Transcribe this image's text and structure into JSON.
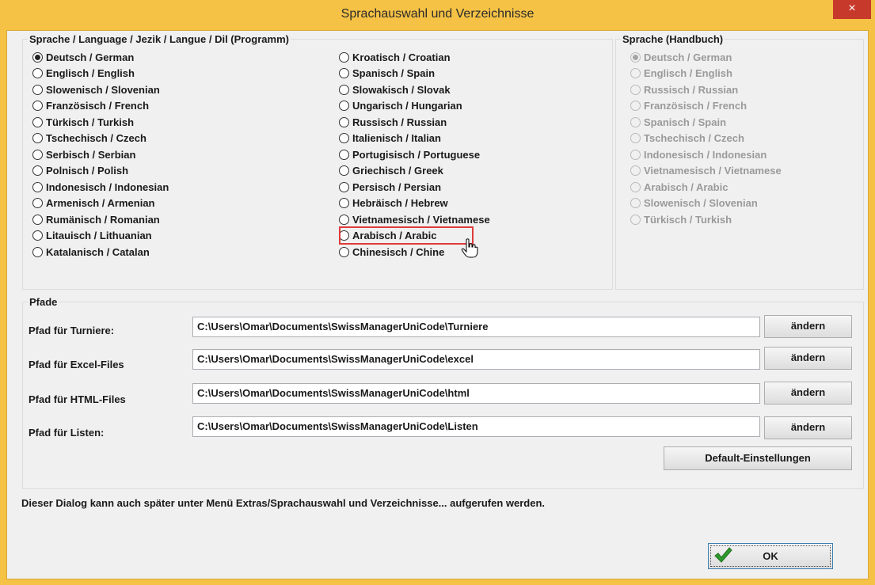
{
  "window": {
    "title": "Sprachauswahl und Verzeichnisse",
    "close": "×"
  },
  "program_language": {
    "legend": "Sprache / Language / Jezik / Langue / Dil (Programm)",
    "selected": "Deutsch / German",
    "col1": [
      "Deutsch / German",
      "Englisch / English",
      "Slowenisch / Slovenian",
      "Französisch / French",
      "Türkisch / Turkish",
      "Tschechisch / Czech",
      "Serbisch / Serbian",
      "Polnisch / Polish",
      "Indonesisch / Indonesian",
      "Armenisch / Armenian",
      "Rumänisch / Romanian",
      "Litauisch / Lithuanian",
      "Katalanisch / Catalan"
    ],
    "col2": [
      "Kroatisch / Croatian",
      "Spanisch / Spain",
      "Slowakisch / Slovak",
      "Ungarisch / Hungarian",
      "Russisch / Russian",
      "Italienisch / Italian",
      "Portugisisch / Portuguese",
      "Griechisch / Greek",
      "Persisch / Persian",
      "Hebräisch / Hebrew",
      "Vietnamesisch / Vietnamese",
      "Arabisch / Arabic",
      "Chinesisch / Chine"
    ]
  },
  "manual_language": {
    "legend": "Sprache (Handbuch)",
    "selected": "Deutsch / German",
    "items": [
      "Deutsch / German",
      "Englisch / English",
      "Russisch / Russian",
      "Französisch / French",
      "Spanisch / Spain",
      "Tschechisch / Czech",
      "Indonesisch / Indonesian",
      "Vietnamesisch / Vietnamese",
      "Arabisch / Arabic",
      "Slowenisch / Slovenian",
      "Türkisch / Turkish"
    ]
  },
  "paths": {
    "legend": "Pfade",
    "rows": [
      {
        "label": "Pfad für Turniere:",
        "value": "C:\\Users\\Omar\\Documents\\SwissManagerUniCode\\Turniere",
        "button": "ändern"
      },
      {
        "label": "Pfad für Excel-Files",
        "value": "C:\\Users\\Omar\\Documents\\SwissManagerUniCode\\excel",
        "button": "ändern"
      },
      {
        "label": "Pfad für HTML-Files",
        "value": "C:\\Users\\Omar\\Documents\\SwissManagerUniCode\\html",
        "button": "ändern"
      },
      {
        "label": "Pfad für Listen:",
        "value": "C:\\Users\\Omar\\Documents\\SwissManagerUniCode\\Listen",
        "button": "ändern"
      }
    ],
    "default_button": "Default-Einstellungen"
  },
  "info_text": "Dieser Dialog kann auch später unter Menü Extras/Sprachauswahl und Verzeichnisse... aufgerufen werden.",
  "ok_button": "OK",
  "colors": {
    "title_bar": "#F5C245",
    "close_button": "#C7392A",
    "highlight": "#E03A3A",
    "check_green": "#2E9B2E"
  }
}
